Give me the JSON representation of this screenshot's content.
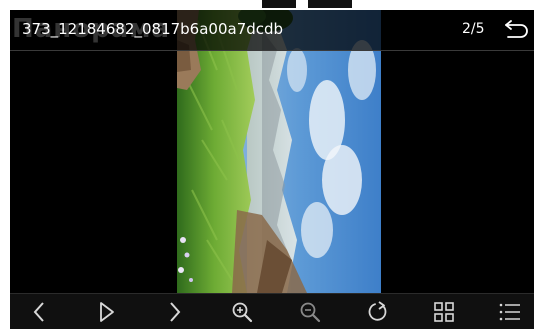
{
  "header": {
    "watermark": "Панорама",
    "file_title": "373_12184682_0817b6a00a7dcdb",
    "counter": "2/5"
  },
  "icons": {
    "back": "return-arrow-icon",
    "prev": "chevron-left-icon",
    "play": "play-icon",
    "next": "chevron-right-icon",
    "zoom_in": "zoom-in-icon",
    "zoom_out": "zoom-out-icon",
    "rotate": "rotate-icon",
    "grid": "grid-icon",
    "list": "list-icon"
  },
  "colors": {
    "toolbar_icon": "#d8d8d8",
    "toolbar_icon_disabled": "#8a8a8a",
    "header_bg": "#000000"
  }
}
